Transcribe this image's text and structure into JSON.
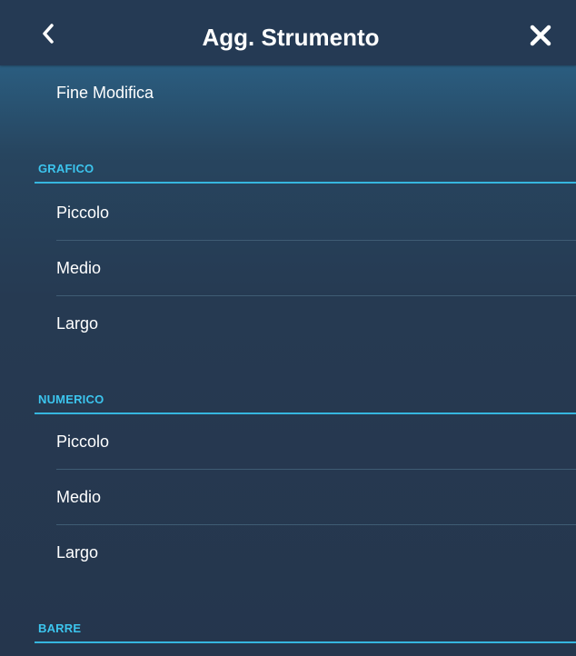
{
  "header": {
    "title": "Agg. Strumento",
    "back_icon": "chevron-left-icon",
    "close_icon": "close-icon"
  },
  "actions": {
    "finish_label": "Fine Modifica"
  },
  "sections": [
    {
      "title": "GRAFICO",
      "items": [
        "Piccolo",
        "Medio",
        "Largo"
      ]
    },
    {
      "title": "NUMERICO",
      "items": [
        "Piccolo",
        "Medio",
        "Largo"
      ]
    },
    {
      "title": "BARRE",
      "items": []
    }
  ],
  "colors": {
    "accent": "#36b6df",
    "header_bg": "#253a54",
    "panel_bg": "#263a52"
  }
}
